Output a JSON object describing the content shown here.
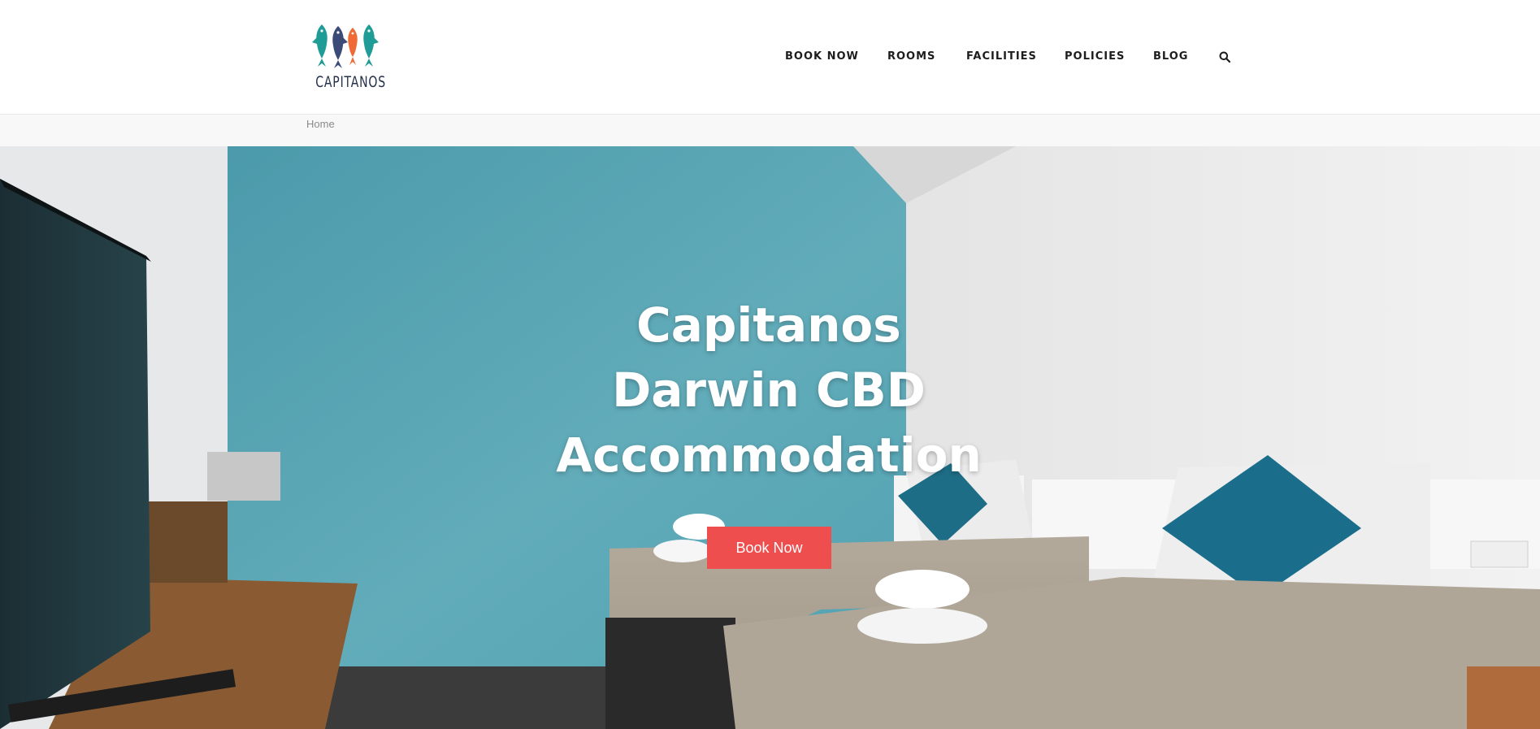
{
  "brand": {
    "name": "CAPITANOS"
  },
  "nav": {
    "items": [
      {
        "label": "BOOK NOW"
      },
      {
        "label": "ROOMS"
      },
      {
        "label": "FACILITIES"
      },
      {
        "label": "POLICIES"
      },
      {
        "label": "BLOG"
      }
    ],
    "search_icon": "search-icon"
  },
  "breadcrumb": {
    "home": "Home"
  },
  "hero": {
    "title_lines": [
      "Capitanos",
      "Darwin CBD",
      "Accommodation"
    ],
    "button_label": "Book Now"
  },
  "colors": {
    "accent": "#ef4e4e",
    "wall": "#5aa9b8",
    "text_dark": "#1d1d1d"
  }
}
